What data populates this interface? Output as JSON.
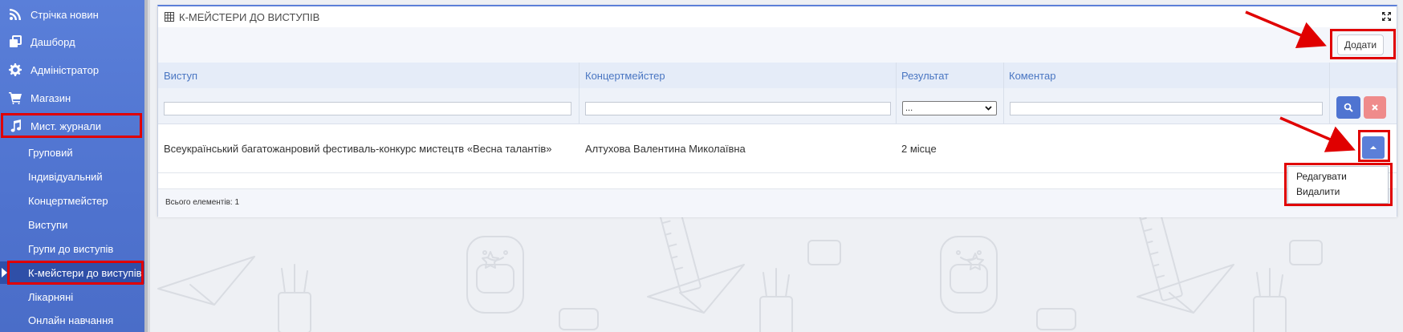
{
  "sidebar": {
    "items": [
      {
        "label": "Стрічка новин",
        "icon": "rss-icon"
      },
      {
        "label": "Дашборд",
        "icon": "dashboard-icon"
      },
      {
        "label": "Адміністратор",
        "icon": "gear-icon"
      },
      {
        "label": "Магазин",
        "icon": "cart-icon"
      },
      {
        "label": "Мист. журнали",
        "icon": "music-icon"
      }
    ],
    "subitems": [
      {
        "label": "Груповий"
      },
      {
        "label": "Індивідуальний"
      },
      {
        "label": "Концертмейстер"
      },
      {
        "label": "Виступи"
      },
      {
        "label": "Групи до виступів"
      },
      {
        "label": "К-мейстери до виступів",
        "active": true
      },
      {
        "label": "Лікарняні"
      },
      {
        "label": "Онлайн навчання"
      }
    ]
  },
  "panel": {
    "title": "К-МЕЙСТЕРИ ДО ВИСТУПІВ",
    "add_label": "Додати",
    "columns": [
      "Виступ",
      "Концертмейстер",
      "Результат",
      "Коментар"
    ],
    "filters": {
      "result_select_value": "..."
    },
    "rows": [
      {
        "vystup": "Всеукраїнський багатожанровий фестиваль-конкурс мистецтв «Весна талантів»",
        "koncertmeister": "Алтухова Валентина Миколаївна",
        "result": "2 місце",
        "comment": ""
      }
    ],
    "footer": "Всього елементів: 1"
  },
  "dropdown": {
    "items": [
      "Редагувати",
      "Видалити"
    ]
  },
  "colors": {
    "sidebar": "#5a7fd9",
    "accent": "#4f74d1",
    "highlight": "#e00000",
    "header_text": "#4a76c2"
  }
}
